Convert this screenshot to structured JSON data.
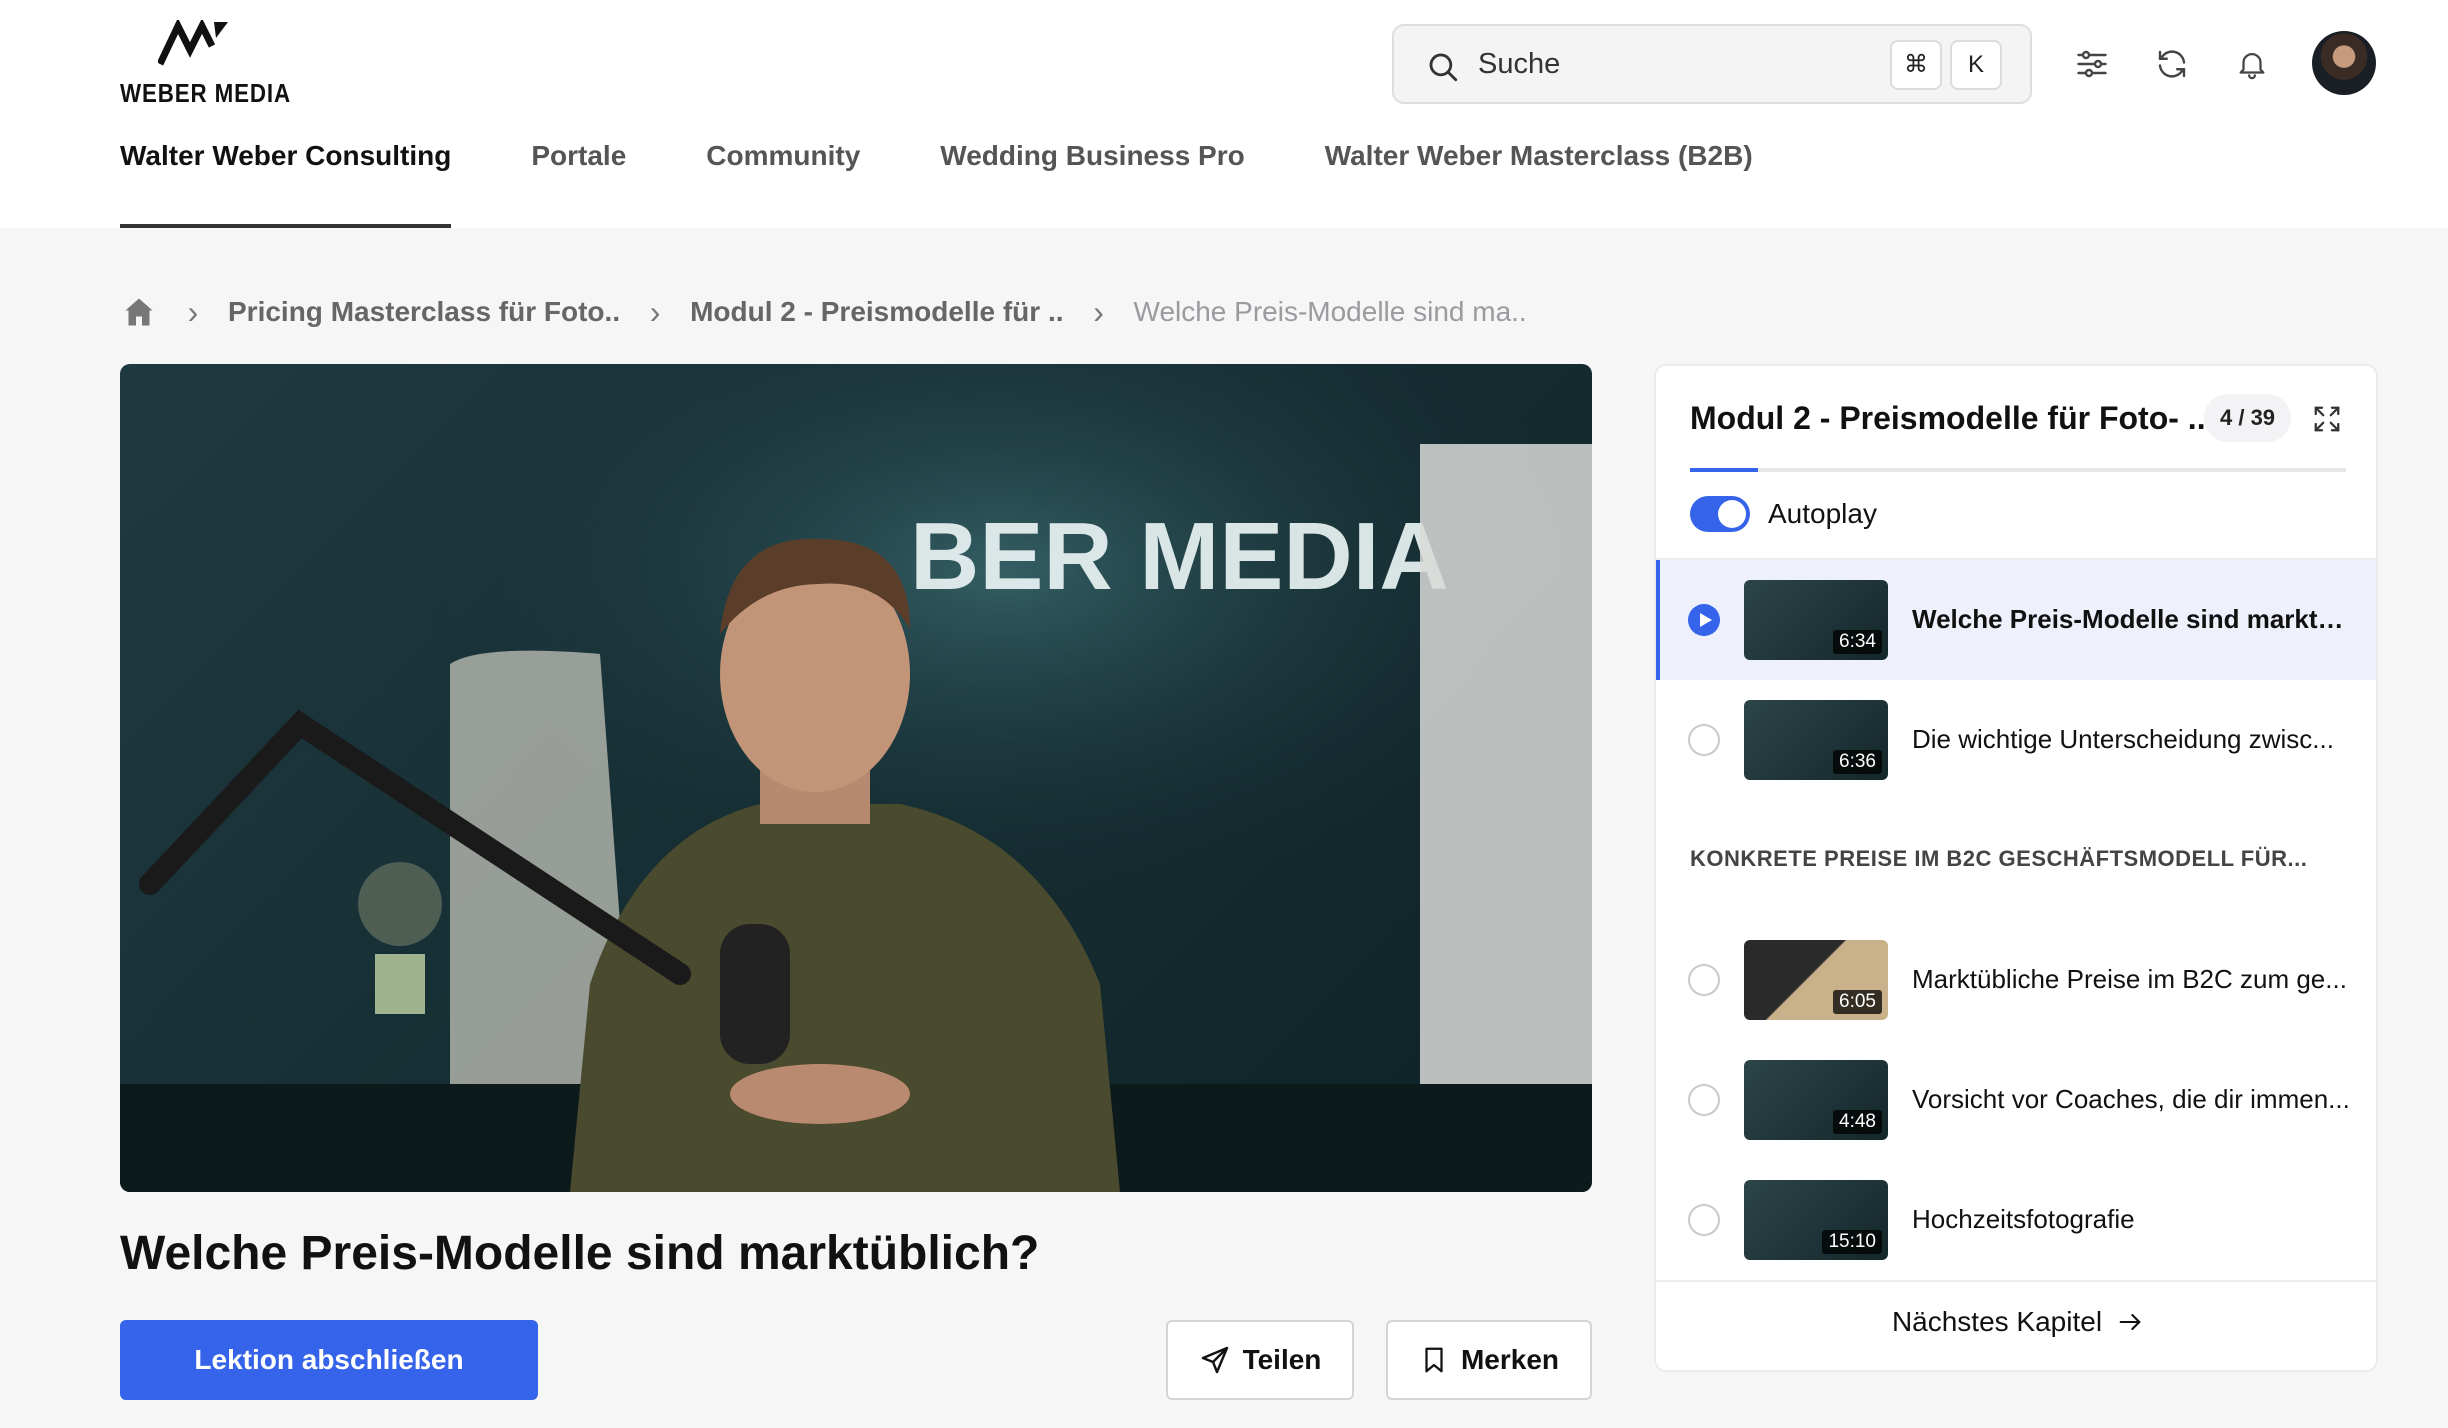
{
  "brand": {
    "name": "WEBER MEDIA"
  },
  "search": {
    "placeholder": "Suche",
    "shortcut_key1": "⌘",
    "shortcut_key2": "K"
  },
  "header_icons": [
    "filter-icon",
    "refresh-icon",
    "bell-icon"
  ],
  "nav": {
    "items": [
      {
        "label": "Walter Weber Consulting",
        "active": true
      },
      {
        "label": "Portale"
      },
      {
        "label": "Community"
      },
      {
        "label": "Wedding Business Pro"
      },
      {
        "label": "Walter Weber Masterclass (B2B)"
      }
    ]
  },
  "breadcrumb": {
    "items": [
      "Pricing Masterclass für Foto..",
      "Modul 2 - Preismodelle für ..",
      "Welche Preis-Modelle sind ma.."
    ]
  },
  "video": {
    "overlay_text": "BER MEDIA"
  },
  "lesson": {
    "title": "Welche Preis-Modelle sind marktüblich?",
    "complete_label": "Lektion abschließen",
    "share_label": "Teilen",
    "save_label": "Merken"
  },
  "sidebar": {
    "module_title": "Modul 2 - Preismodelle für Foto- ...",
    "counter": "4 / 39",
    "progress_fraction": 0.103,
    "autoplay_label": "Autoplay",
    "autoplay_on": true,
    "section_label": "KONKRETE PREISE IM B2C GESCHÄFTSMODELL FÜR...",
    "lessons": [
      {
        "title": "Welche Preis-Modelle sind marktüb...",
        "duration": "6:34",
        "active": true
      },
      {
        "title": "Die wichtige Unterscheidung zwisc...",
        "duration": "6:36"
      },
      {
        "title": "Marktübliche Preise im B2C zum ge...",
        "duration": "6:05"
      },
      {
        "title": "Vorsicht vor Coaches, die dir immen...",
        "duration": "4:48"
      },
      {
        "title": "Hochzeitsfotografie",
        "duration": "15:10"
      }
    ],
    "next_chapter_label": "Nächstes Kapitel"
  },
  "colors": {
    "accent": "#3563e9",
    "text": "#111111",
    "muted": "#666666",
    "background": "#f6f6f7"
  }
}
